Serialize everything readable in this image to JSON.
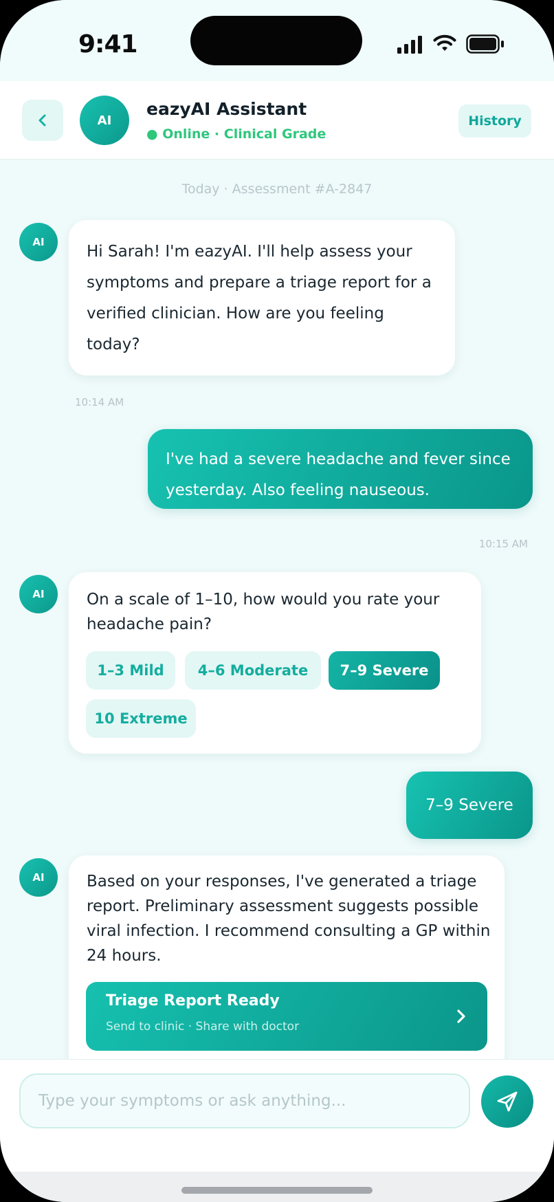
{
  "status_bar": {
    "time": "9:41"
  },
  "header": {
    "avatar_text": "AI",
    "title": "eazyAI Assistant",
    "status": "● Online · Clinical Grade",
    "history_label": "History"
  },
  "chat": {
    "date_label": "Today · Assessment #A-2847",
    "messages": [
      {
        "sender": "ai",
        "avatar": "AI",
        "text": "Hi Sarah! I'm eazyAI. I'll help assess your symptoms and prepare a triage report for a verified clinician. How are you feeling today?",
        "time": "10:14 AM"
      },
      {
        "sender": "user",
        "text": "I've had a severe headache and fever since yesterday. Also feeling nauseous.",
        "time": "10:15 AM"
      },
      {
        "sender": "ai",
        "avatar": "AI",
        "text": "On a scale of 1–10, how would you rate your headache pain?",
        "options": [
          "1–3 Mild",
          "4–6 Moderate",
          "7–9 Severe",
          "10 Extreme"
        ],
        "selected_option": "7–9 Severe"
      },
      {
        "sender": "user",
        "text": "7–9 Severe"
      },
      {
        "sender": "ai",
        "avatar": "AI",
        "text": "Based on your responses, I've generated a triage report. Preliminary assessment suggests possible viral infection. I recommend consulting a GP within 24 hours.",
        "card": {
          "title": "Triage Report Ready",
          "subtitle": "Send to clinic · Share with doctor"
        }
      }
    ]
  },
  "composer": {
    "placeholder": "Type your symptoms or ask anything..."
  },
  "colors": {
    "accent": "#10a79a",
    "accent_light": "#e3f7f5",
    "online": "#2ec77c",
    "background": "#effafa"
  },
  "icons": [
    "chevron-left-icon",
    "send-icon",
    "chevron-right-icon",
    "signal-icon",
    "wifi-icon",
    "battery-icon"
  ]
}
